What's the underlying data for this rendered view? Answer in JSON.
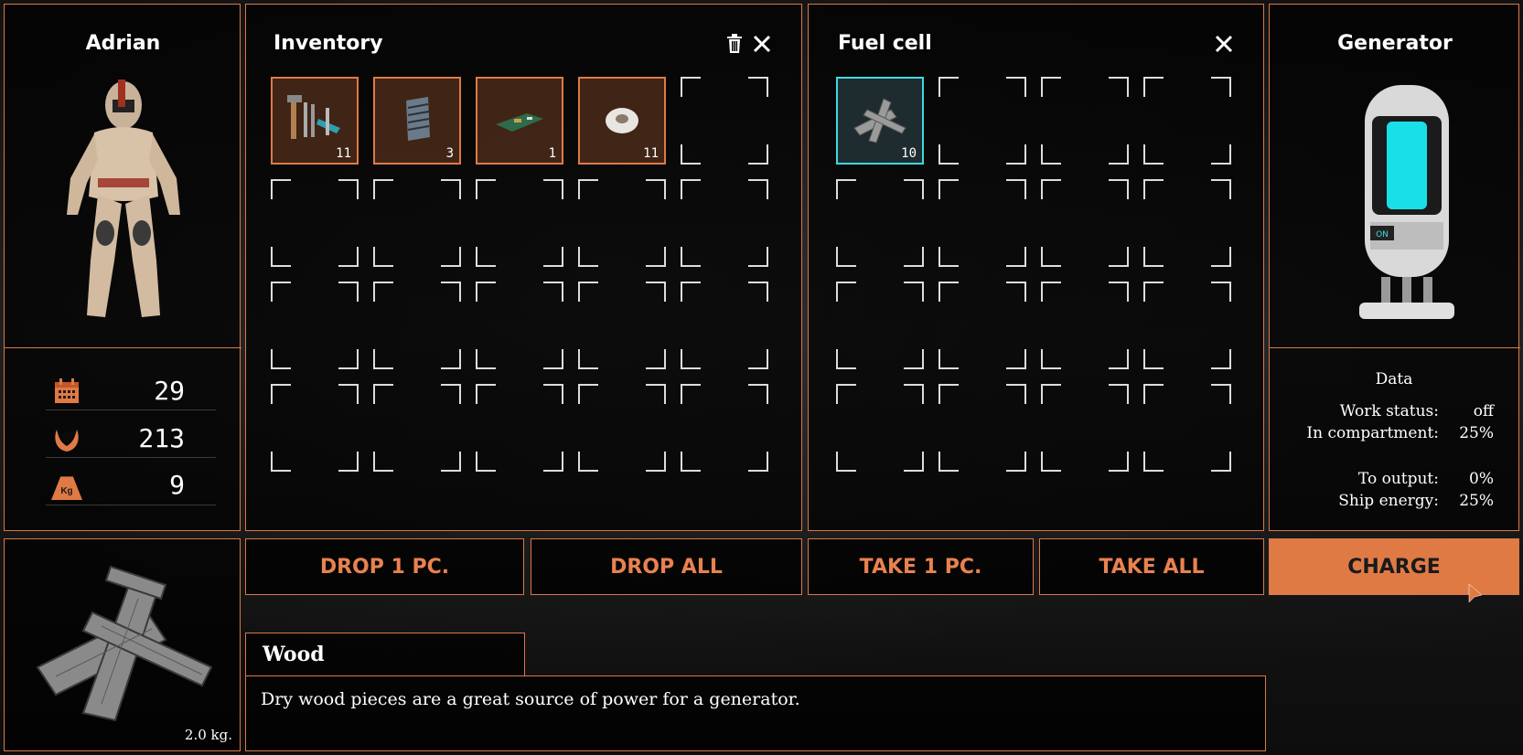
{
  "character": {
    "name": "Adrian"
  },
  "stats": [
    {
      "icon": "calendar-icon",
      "value": "29"
    },
    {
      "icon": "laurel-wreath-icon",
      "value": "213"
    },
    {
      "icon": "kg-weight-icon",
      "value": "9",
      "icon_text": "Kg"
    }
  ],
  "inventory": {
    "title": "Inventory",
    "items": [
      {
        "name": "tools",
        "qty": "11"
      },
      {
        "name": "metal-plate",
        "qty": "3"
      },
      {
        "name": "circuit-board",
        "qty": "1"
      },
      {
        "name": "tape",
        "qty": "11"
      }
    ]
  },
  "fuel_cell": {
    "title": "Fuel cell",
    "items": [
      {
        "name": "wood",
        "qty": "10"
      }
    ]
  },
  "generator": {
    "title": "Generator",
    "status_light": "ON",
    "data_heading": "Data",
    "rows": [
      {
        "label": "Work status:",
        "value": "off"
      },
      {
        "label": "In compartment:",
        "value": "25%"
      },
      {
        "label": "To output:",
        "value": "0%"
      },
      {
        "label": "Ship energy:",
        "value": "25%"
      }
    ]
  },
  "buttons": {
    "drop_one": "DROP 1 PC.",
    "drop_all": "DROP ALL",
    "take_one": "TAKE 1 PC.",
    "take_all": "TAKE ALL",
    "charge": "CHARGE"
  },
  "selected_item": {
    "name": "Wood",
    "weight": "2.0 kg.",
    "description": "Dry wood pieces are a great source of power for a generator."
  },
  "colors": {
    "accent": "#e07a45",
    "selected": "#3fd8e0",
    "panel_border": "#d8784a"
  }
}
